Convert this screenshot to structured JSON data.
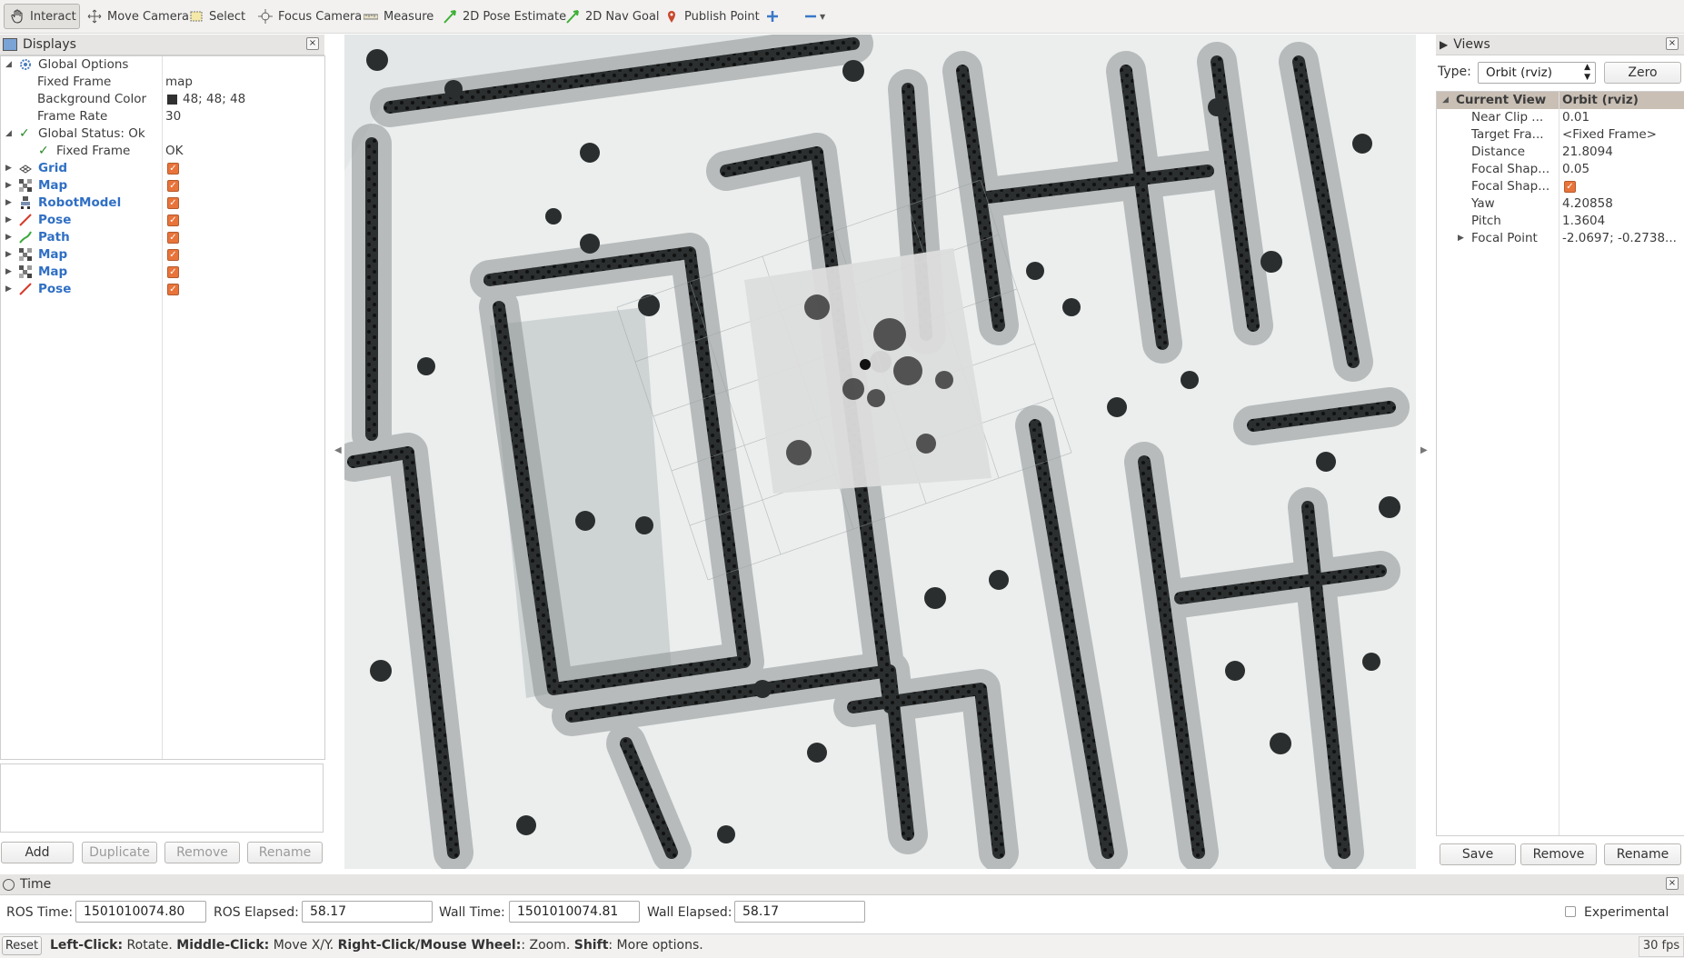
{
  "toolbar": {
    "tools": [
      {
        "label": "Interact",
        "icon": "hand-icon"
      },
      {
        "label": "Move Camera",
        "icon": "move-camera-icon"
      },
      {
        "label": "Select",
        "icon": "select-box-icon"
      },
      {
        "label": "Focus Camera",
        "icon": "focus-camera-icon"
      },
      {
        "label": "Measure",
        "icon": "ruler-icon"
      },
      {
        "label": "2D Pose Estimate",
        "icon": "green-arrow-icon"
      },
      {
        "label": "2D Nav Goal",
        "icon": "green-arrow-icon"
      },
      {
        "label": "Publish Point",
        "icon": "map-pin-icon"
      }
    ]
  },
  "displays": {
    "title": "Displays",
    "global_options": {
      "label": "Global Options",
      "fixed_frame_label": "Fixed Frame",
      "fixed_frame_value": "map",
      "background_label": "Background Color",
      "background_value": "48; 48; 48",
      "background_swatch": "#303030",
      "frame_rate_label": "Frame Rate",
      "frame_rate_value": "30"
    },
    "global_status": {
      "label": "Global Status: Ok",
      "fixed_frame_label": "Fixed Frame",
      "fixed_frame_value": "OK"
    },
    "items": [
      {
        "label": "Grid",
        "icon": "grid-icon"
      },
      {
        "label": "Map",
        "icon": "map-icon"
      },
      {
        "label": "RobotModel",
        "icon": "robot-model-icon"
      },
      {
        "label": "Pose",
        "icon": "pose-arrow-icon"
      },
      {
        "label": "Path",
        "icon": "path-icon"
      },
      {
        "label": "Map",
        "icon": "map-icon"
      },
      {
        "label": "Map",
        "icon": "map-icon"
      },
      {
        "label": "Pose",
        "icon": "pose-arrow-icon"
      }
    ],
    "buttons": {
      "add": "Add",
      "duplicate": "Duplicate",
      "remove": "Remove",
      "rename": "Rename"
    }
  },
  "views": {
    "title": "Views",
    "type_label": "Type:",
    "type_value": "Orbit (rviz)",
    "zero_label": "Zero",
    "current_view": {
      "label": "Current View",
      "value": "Orbit (rviz)"
    },
    "props": [
      {
        "label": "Near Clip ...",
        "value": "0.01"
      },
      {
        "label": "Target Fra...",
        "value": "<Fixed Frame>"
      },
      {
        "label": "Distance",
        "value": "21.8094"
      },
      {
        "label": "Focal Shap...",
        "value": "0.05"
      },
      {
        "label": "Focal Shap...",
        "value": ""
      },
      {
        "label": "Yaw",
        "value": "4.20858"
      },
      {
        "label": "Pitch",
        "value": "1.3604"
      },
      {
        "label": "Focal Point",
        "value": "-2.0697; -0.2738..."
      }
    ],
    "buttons": {
      "save": "Save",
      "remove": "Remove",
      "rename": "Rename"
    }
  },
  "time": {
    "title": "Time",
    "ros_time_label": "ROS Time:",
    "ros_time_value": "1501010074.80",
    "ros_elapsed_label": "ROS Elapsed:",
    "ros_elapsed_value": "58.17",
    "wall_time_label": "Wall Time:",
    "wall_time_value": "1501010074.81",
    "wall_elapsed_label": "Wall Elapsed:",
    "wall_elapsed_value": "58.17",
    "experimental_label": "Experimental"
  },
  "statusbar": {
    "reset": "Reset",
    "left_click": "Left-Click:",
    "left_click_desc": " Rotate. ",
    "middle_click": "Middle-Click:",
    "middle_click_desc": " Move X/Y. ",
    "right_click": "Right-Click/Mouse Wheel:",
    "right_click_desc": ": Zoom. ",
    "shift": "Shift",
    "shift_desc": ": More options.",
    "fps": "30 fps"
  }
}
